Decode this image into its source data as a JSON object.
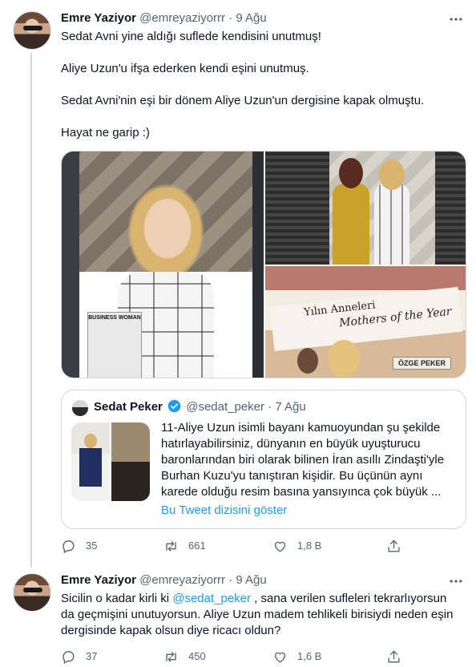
{
  "tweet1": {
    "display_name": "Emre Yaziyor",
    "handle": "@emreyaziyorrr",
    "separator": "·",
    "date": "9 Ağu",
    "paragraphs": [
      "Sedat Avni yine aldığı suflede kendisini unutmuş!",
      "Aliye Uzun'u ifşa ederken kendi eşini unutmuş.",
      "Sedat Avni'nin eşi bir dönem Aliye Uzun'un dergisine kapak olmuştu.",
      "Hayat ne garip :)"
    ],
    "media": {
      "magazine_cover_text": "BUSINESS WOMAN",
      "banner_line1": "Yılın Anneleri",
      "banner_line2": "Mothers of the Year",
      "name_label": "ÖZGE PEKER"
    },
    "quoted": {
      "display_name": "Sedat Peker",
      "handle": "@sedat_peker",
      "separator": "·",
      "date": "7 Ağu",
      "text": "11-Aliye Uzun isimli bayanı kamuoyundan şu şekilde hatırlayabilirsiniz, dünyanın en büyük uyuşturucu baronlarından biri olarak bilinen İran asıllı Zindaşti'yle Burhan Kuzu'yu tanıştıran kişidir. Bu üçünün aynı karede olduğu resim basına yansıyınca çok büyük ...",
      "show_thread": "Bu Tweet dizisini göster"
    },
    "actions": {
      "replies": "35",
      "retweets": "661",
      "likes": "1,8 B"
    }
  },
  "tweet2": {
    "display_name": "Emre Yaziyor",
    "handle": "@emreyaziyorrr",
    "separator": "·",
    "date": "9 Ağu",
    "text_before": "Sicilin o kadar kirli ki ",
    "mention": "@sedat_peker",
    "text_after": " , sana verilen sufleleri tekrarlıyorsun da geçmişini unutuyorsun. Aliye Uzun madem tehlikeli birisiydi neden eşin dergisinde kapak olsun diye ricacı oldun?",
    "actions": {
      "replies": "37",
      "retweets": "450",
      "likes": "1,6 B"
    }
  },
  "icons": {
    "more": "more-icon",
    "reply": "reply-icon",
    "retweet": "retweet-icon",
    "like": "heart-icon",
    "share": "share-icon",
    "verified": "verified-badge-icon"
  },
  "colors": {
    "accent": "#1d9bf0",
    "secondary_text": "#536471",
    "border": "#cfd9de"
  }
}
